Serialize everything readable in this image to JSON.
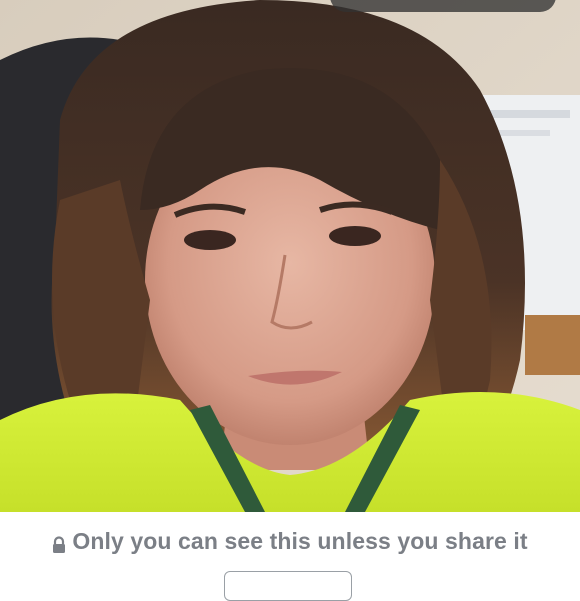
{
  "photo": {
    "subject": "selfie-photo"
  },
  "privacy": {
    "icon": "lock-icon",
    "text": "Only you can see this unless you share it"
  },
  "colors": {
    "privacy_text": "#7b7f86",
    "button_border": "#9aa0a6",
    "overlay_pill": "#323232"
  }
}
